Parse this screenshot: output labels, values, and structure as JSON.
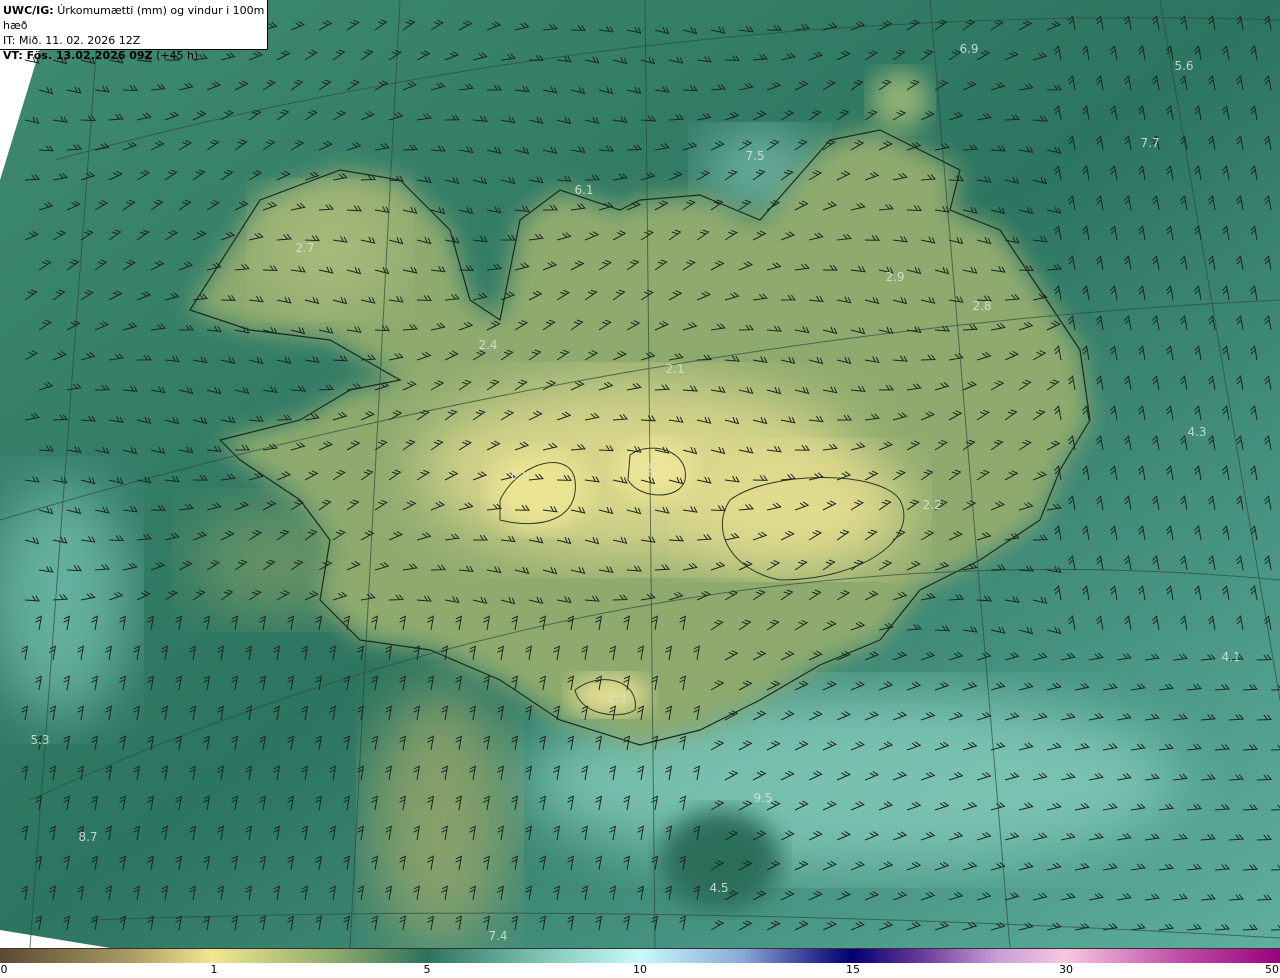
{
  "header": {
    "model": "UWC/IG:",
    "description": "Úrkomumætti (mm) og vindur i 100m hæð",
    "initial_time": "IT: Mið. 11. 02. 2026 12Z",
    "valid_time_label": "VT: Fös. 13.02.2026 09Z",
    "lead_time": "(+45 h)"
  },
  "value_labels": [
    "6.9",
    "5.6",
    "7.5",
    "7.7",
    "6.1",
    "2.7",
    "2.9",
    "2.8",
    "2.4",
    "2.1",
    "1.1",
    "1.2",
    "2.2",
    "4.3",
    "4.1",
    "5.3",
    "8.7",
    "2.3",
    "9.5",
    "4.5",
    "7.4"
  ],
  "colorbar": {
    "ticks": [
      "0",
      "1",
      "5",
      "10",
      "15",
      "30",
      "50"
    ],
    "unit": "mm"
  },
  "colors": {
    "ocean": "#2e7a66",
    "land_low": "#6f9a6a",
    "land_high": "#e2dc8e",
    "coastline": "#1e2a22"
  }
}
